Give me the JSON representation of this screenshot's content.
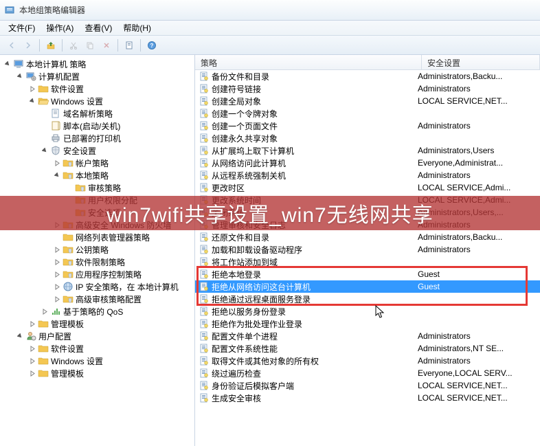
{
  "title": "本地组策略编辑器",
  "menu": {
    "file": "文件(F)",
    "action": "操作(A)",
    "view": "查看(V)",
    "help": "帮助(H)"
  },
  "columns": {
    "policy": "策略",
    "security": "安全设置"
  },
  "tree": [
    {
      "d": 0,
      "t": "open",
      "icon": "computer",
      "label": "本地计算机 策略"
    },
    {
      "d": 1,
      "t": "open",
      "icon": "computer-cfg",
      "label": "计算机配置"
    },
    {
      "d": 2,
      "t": "closed",
      "icon": "folder",
      "label": "软件设置"
    },
    {
      "d": 2,
      "t": "open",
      "icon": "folder-open",
      "label": "Windows 设置"
    },
    {
      "d": 3,
      "t": "leaf",
      "icon": "doc",
      "label": "域名解析策略"
    },
    {
      "d": 3,
      "t": "leaf",
      "icon": "script",
      "label": "脚本(启动/关机)"
    },
    {
      "d": 3,
      "t": "leaf",
      "icon": "printer",
      "label": "已部署的打印机"
    },
    {
      "d": 3,
      "t": "open",
      "icon": "shield",
      "label": "安全设置"
    },
    {
      "d": 4,
      "t": "closed",
      "icon": "folder-s",
      "label": "帐户策略"
    },
    {
      "d": 4,
      "t": "open",
      "icon": "folder-s",
      "label": "本地策略"
    },
    {
      "d": 5,
      "t": "leaf",
      "icon": "folder-s",
      "label": "审核策略"
    },
    {
      "d": 5,
      "t": "leaf",
      "icon": "folder-s",
      "label": "用户权限分配"
    },
    {
      "d": 5,
      "t": "leaf",
      "icon": "folder-s",
      "label": "安全选项"
    },
    {
      "d": 4,
      "t": "closed",
      "icon": "folder-s",
      "label": "高级安全 Windows 防火墙"
    },
    {
      "d": 4,
      "t": "leaf",
      "icon": "folder",
      "label": "网络列表管理器策略"
    },
    {
      "d": 4,
      "t": "closed",
      "icon": "folder-s",
      "label": "公钥策略"
    },
    {
      "d": 4,
      "t": "closed",
      "icon": "folder-s",
      "label": "软件限制策略"
    },
    {
      "d": 4,
      "t": "closed",
      "icon": "folder-s",
      "label": "应用程序控制策略"
    },
    {
      "d": 4,
      "t": "closed",
      "icon": "ip",
      "label": "IP 安全策略，在 本地计算机"
    },
    {
      "d": 4,
      "t": "closed",
      "icon": "folder-s",
      "label": "高级审核策略配置"
    },
    {
      "d": 3,
      "t": "closed",
      "icon": "qos",
      "label": "基于策略的 QoS"
    },
    {
      "d": 2,
      "t": "closed",
      "icon": "folder",
      "label": "管理模板"
    },
    {
      "d": 1,
      "t": "open",
      "icon": "user-cfg",
      "label": "用户配置"
    },
    {
      "d": 2,
      "t": "closed",
      "icon": "folder",
      "label": "软件设置"
    },
    {
      "d": 2,
      "t": "closed",
      "icon": "folder",
      "label": "Windows 设置"
    },
    {
      "d": 2,
      "t": "closed",
      "icon": "folder",
      "label": "管理模板"
    }
  ],
  "rows": [
    {
      "p": "备份文件和目录",
      "s": "Administrators,Backu..."
    },
    {
      "p": "创建符号链接",
      "s": "Administrators"
    },
    {
      "p": "创建全局对象",
      "s": "LOCAL SERVICE,NET..."
    },
    {
      "p": "创建一个令牌对象",
      "s": ""
    },
    {
      "p": "创建一个页面文件",
      "s": "Administrators"
    },
    {
      "p": "创建永久共享对象",
      "s": ""
    },
    {
      "p": "从扩展坞上取下计算机",
      "s": "Administrators,Users"
    },
    {
      "p": "从网络访问此计算机",
      "s": "Everyone,Administrat..."
    },
    {
      "p": "从远程系统强制关机",
      "s": "Administrators"
    },
    {
      "p": "更改时区",
      "s": "LOCAL SERVICE,Admi..."
    },
    {
      "p": "更改系统时间",
      "s": "LOCAL SERVICE,Admi..."
    },
    {
      "p": "关闭系统",
      "s": "Administrators,Users,..."
    },
    {
      "p": "管理审核和安全日志",
      "s": "Administrators"
    },
    {
      "p": "还原文件和目录",
      "s": "Administrators,Backu..."
    },
    {
      "p": "加载和卸载设备驱动程序",
      "s": "Administrators"
    },
    {
      "p": "将工作站添加到域",
      "s": ""
    },
    {
      "p": "拒绝本地登录",
      "s": "Guest",
      "box": true
    },
    {
      "p": "拒绝从网络访问这台计算机",
      "s": "Guest",
      "sel": true,
      "box": true
    },
    {
      "p": "拒绝通过远程桌面服务登录",
      "s": "",
      "box": true
    },
    {
      "p": "拒绝以服务身份登录",
      "s": ""
    },
    {
      "p": "拒绝作为批处理作业登录",
      "s": ""
    },
    {
      "p": "配置文件单个进程",
      "s": "Administrators"
    },
    {
      "p": "配置文件系统性能",
      "s": "Administrators,NT SE..."
    },
    {
      "p": "取得文件或其他对象的所有权",
      "s": "Administrators"
    },
    {
      "p": "绕过遍历检查",
      "s": "Everyone,LOCAL SERV..."
    },
    {
      "p": "身份验证后模拟客户端",
      "s": "LOCAL SERVICE,NET..."
    },
    {
      "p": "生成安全审核",
      "s": "LOCAL SERVICE,NET..."
    }
  ],
  "watermark": "win7wifi共享设置_win7无线网共享"
}
